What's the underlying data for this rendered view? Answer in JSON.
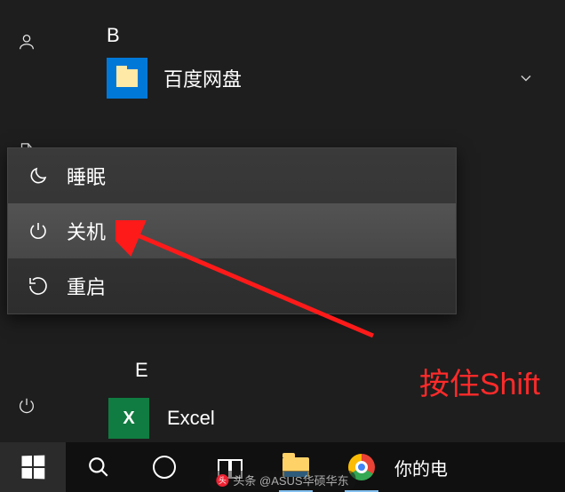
{
  "sections": {
    "B": {
      "letter": "B"
    },
    "E": {
      "letter": "E"
    }
  },
  "apps": {
    "baidu": {
      "label": "百度网盘"
    },
    "excel": {
      "label": "Excel"
    }
  },
  "power_menu": {
    "sleep": "睡眠",
    "shutdown": "关机",
    "restart": "重启"
  },
  "annotation": {
    "text": "按住Shift"
  },
  "taskbar": {
    "right_text": "你的电"
  },
  "watermark": {
    "text": "头条 @ASUS华硕华东"
  }
}
